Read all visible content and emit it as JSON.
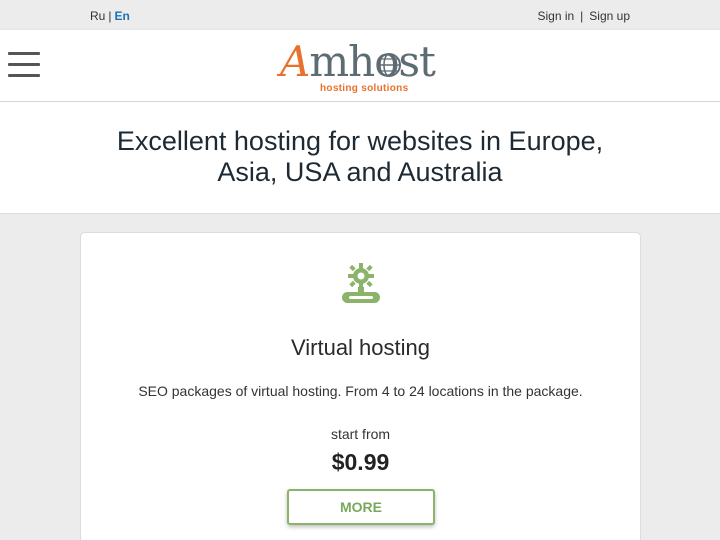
{
  "topbar": {
    "lang_ru": "Ru",
    "lang_sep": "|",
    "lang_en": "En",
    "sign_in": "Sign in",
    "auth_sep": "|",
    "sign_up": "Sign up"
  },
  "header": {
    "logo_main": "mhost",
    "logo_letter": "A",
    "logo_tagline": "hosting solutions",
    "menu_icon": "hamburger-menu-icon"
  },
  "hero": {
    "title": "Excellent hosting for websites in Europe, Asia, USA and Australia"
  },
  "card": {
    "icon": "gear-server-icon",
    "title": "Virtual hosting",
    "description": "SEO packages of virtual hosting. From 4 to 24 locations in the package.",
    "start_from": "start from",
    "price": "$0.99",
    "more_label": "MORE"
  },
  "colors": {
    "brand_orange": "#e8722c",
    "brand_gray": "#5d6b73",
    "accent_green": "#8bb36a",
    "link_blue": "#1a73b8"
  }
}
